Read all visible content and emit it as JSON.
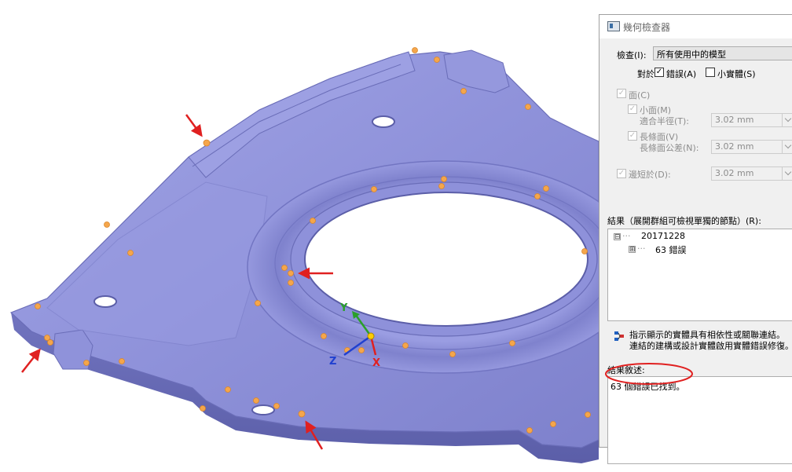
{
  "viewport": {
    "axis_labels": {
      "x": "X",
      "y": "Y",
      "z": "Z"
    },
    "colors": {
      "model": "#8c8fd6",
      "error_dot": "#f5a64b",
      "arrow": "#e02020",
      "annotation": "#e02020"
    }
  },
  "panel": {
    "title": "幾何檢查器",
    "check_label": "檢查(I):",
    "check_value": "所有使用中的模型",
    "for_label": "對於:",
    "errors_checkbox": {
      "label": "錯誤(A)",
      "checked": true
    },
    "small_solids_checkbox": {
      "label": "小實體(S)",
      "checked": false
    },
    "faces_checkbox": {
      "label": "面(C)",
      "checked": true
    },
    "small_faces_checkbox": {
      "label": "小面(M)",
      "checked": true
    },
    "fit_radius_label": "適合半徑(T):",
    "fit_radius_value": "3.02 mm",
    "long_faces_checkbox": {
      "label": "長條面(V)",
      "checked": true
    },
    "long_face_tolerance_label": "長條面公差(N):",
    "long_face_tolerance_value": "3.02 mm",
    "edge_short_checkbox": {
      "label": "邊短於(D):",
      "checked": true
    },
    "edge_short_value": "3.02 mm",
    "results_label": "結果（展開群組可檢視單獨的節點）(R):",
    "tree": {
      "root": {
        "expander": "⊟",
        "label": "20171228"
      },
      "child": {
        "expander": "⊞",
        "label": "63 錯誤"
      }
    },
    "info_line1": "指示顯示的實體具有相依性或關聯連結。",
    "info_line2": "連結的建構或設計實體啟用實體錯誤修復。",
    "summary_label": "結果敘述:",
    "summary_text": "63 個錯誤已找到。"
  }
}
